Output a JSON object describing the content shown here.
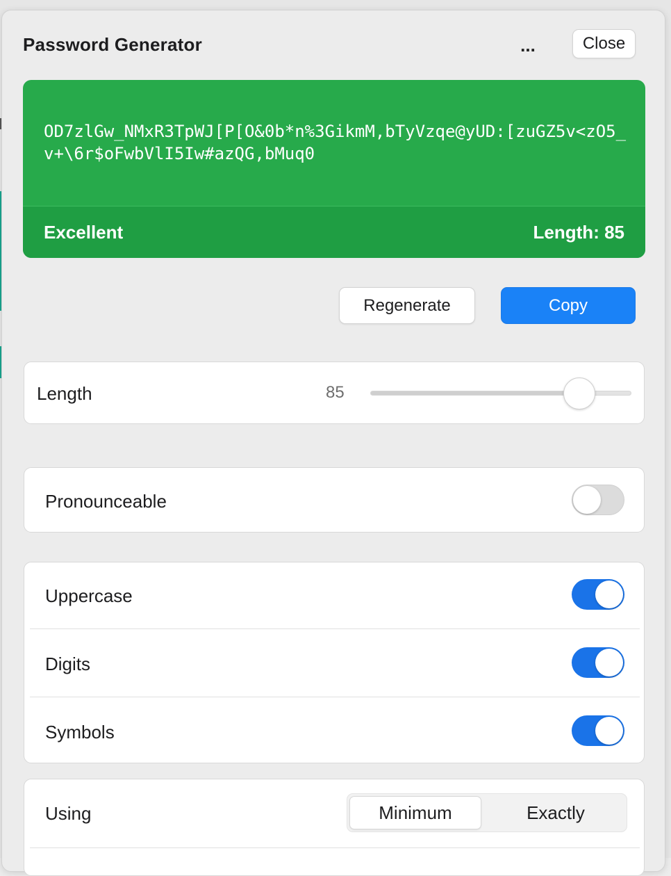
{
  "header": {
    "title": "Password Generator",
    "more_label": "...",
    "close_label": "Close"
  },
  "password": {
    "value": "OD7zlGw_NMxR3TpWJ[P[O&0b*n%3GikmM,bTyVzqe@yUD:[zuGZ5v<zO5_v+\\6r$oFwbVlI5Iw#azQG,bMuq0",
    "strength": "Excellent",
    "length_label": "Length: 85",
    "strength_color": "#27aa4b"
  },
  "actions": {
    "regenerate_label": "Regenerate",
    "copy_label": "Copy",
    "copy_color": "#1a82f7"
  },
  "length_setting": {
    "label": "Length",
    "value": "85",
    "slider_fraction": 0.8
  },
  "options": {
    "pronounceable": {
      "label": "Pronounceable",
      "on": false
    },
    "uppercase": {
      "label": "Uppercase",
      "on": true
    },
    "digits": {
      "label": "Digits",
      "on": true
    },
    "symbols": {
      "label": "Symbols",
      "on": true
    },
    "toggle_on_color": "#1a73e8"
  },
  "using": {
    "label": "Using",
    "options": [
      "Minimum",
      "Exactly"
    ],
    "selected": "Minimum"
  }
}
